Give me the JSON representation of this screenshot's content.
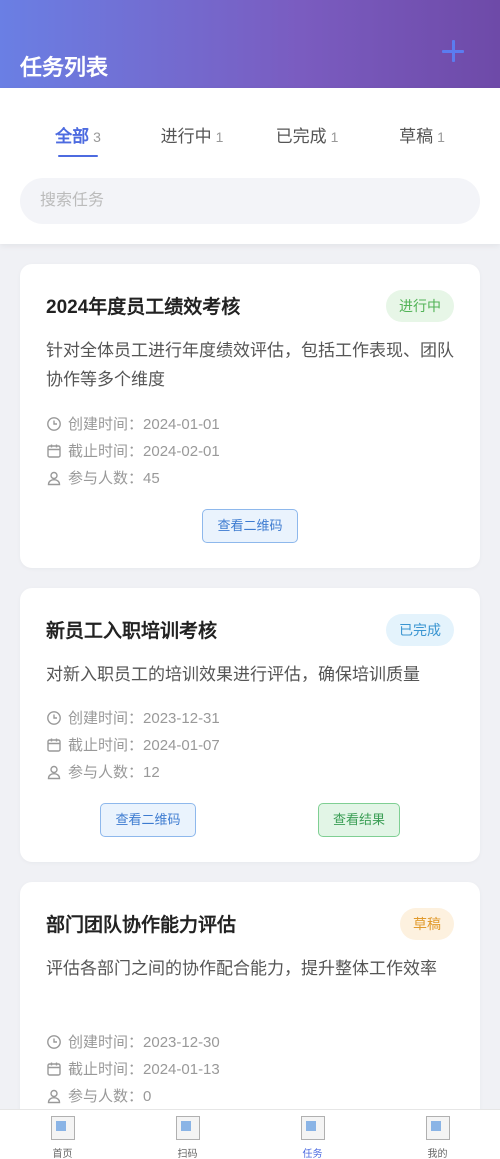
{
  "header": {
    "title": "任务列表"
  },
  "tabs": [
    {
      "label": "全部",
      "count": "3"
    },
    {
      "label": "进行中",
      "count": "1"
    },
    {
      "label": "已完成",
      "count": "1"
    },
    {
      "label": "草稿",
      "count": "1"
    }
  ],
  "search": {
    "placeholder": "搜索任务"
  },
  "meta_labels": {
    "created": "创建时间：",
    "deadline": "截止时间：",
    "participants": "参与人数："
  },
  "tasks": [
    {
      "title": "2024年度员工绩效考核",
      "status": "进行中",
      "description": "针对全体员工进行年度绩效评估，包括工作表现、团队协作等多个维度",
      "created": "2024-01-01",
      "deadline": "2024-02-01",
      "participants": "45",
      "qr_button": "查看二维码"
    },
    {
      "title": "新员工入职培训考核",
      "status": "已完成",
      "description": "对新入职员工的培训效果进行评估，确保培训质量",
      "created": "2023-12-31",
      "deadline": "2024-01-07",
      "participants": "12",
      "qr_button": "查看二维码",
      "result_button": "查看结果"
    },
    {
      "title": "部门团队协作能力评估",
      "status": "草稿",
      "description": "评估各部门之间的协作配合能力，提升整体工作效率",
      "created": "2023-12-30",
      "deadline": "2024-01-13",
      "participants": "0"
    }
  ],
  "tabbar": [
    {
      "label": "首页"
    },
    {
      "label": "扫码"
    },
    {
      "label": "任务"
    },
    {
      "label": "我的"
    }
  ],
  "colors": {
    "accent": "#4d6be0",
    "header_start": "#6a7fe4",
    "header_end": "#6e4aa8"
  }
}
